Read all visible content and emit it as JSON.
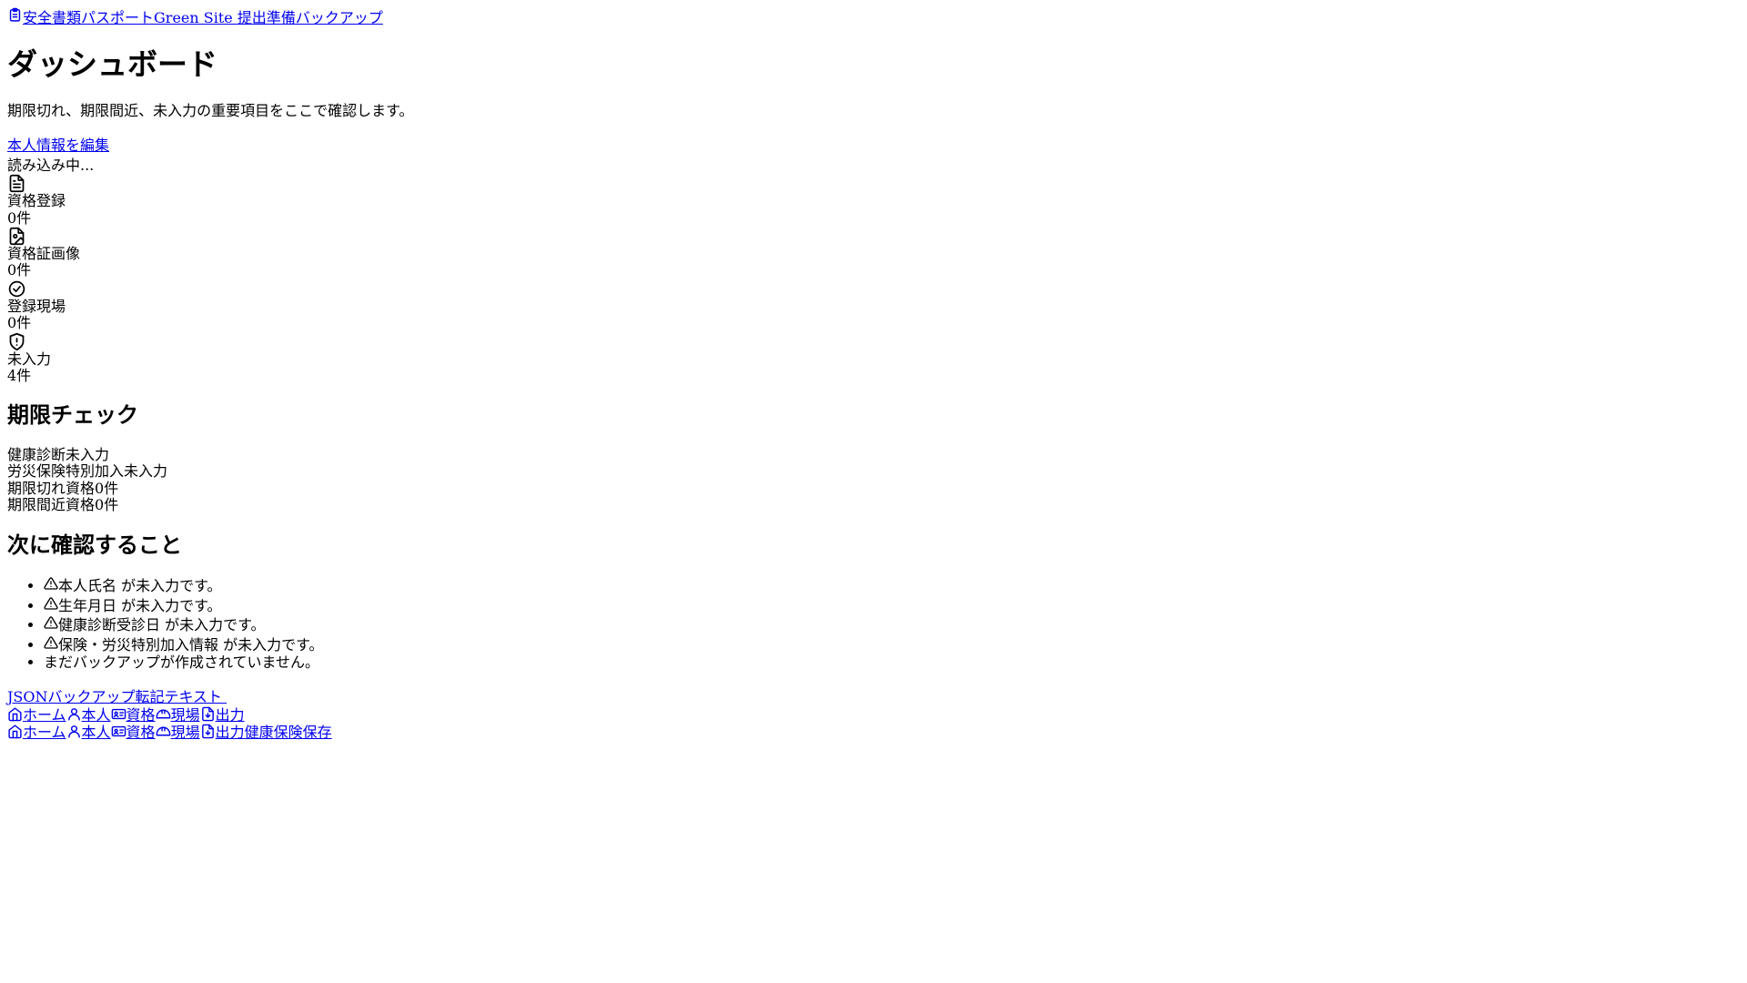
{
  "header": {
    "app_name": "安全書類パスポート",
    "links": [
      "Green Site 提出準備",
      "バックアップ"
    ]
  },
  "page": {
    "title": "ダッシュボード",
    "subtitle": "期限切れ、期限間近、未入力の重要項目をここで確認します。",
    "edit_link": "本人情報を編集",
    "loading": "読み込み中..."
  },
  "stats": [
    {
      "icon": "file-text-icon",
      "label": "資格登録",
      "value": "0件"
    },
    {
      "icon": "file-image-icon",
      "label": "資格証画像",
      "value": "0件"
    },
    {
      "icon": "check-circle-icon",
      "label": "登録現場",
      "value": "0件"
    },
    {
      "icon": "shield-alert-icon",
      "label": "未入力",
      "value": "4件"
    }
  ],
  "deadline": {
    "title": "期限チェック",
    "rows": [
      {
        "label": "健康診断",
        "value": "未入力"
      },
      {
        "label": "労災保険特別加入",
        "value": "未入力"
      },
      {
        "label": "期限切れ資格",
        "value": "0件"
      },
      {
        "label": "期限間近資格",
        "value": "0件"
      }
    ]
  },
  "next": {
    "title": "次に確認すること",
    "items": [
      {
        "icon": "warning-icon",
        "text": "本人氏名 が未入力です。"
      },
      {
        "icon": "warning-icon",
        "text": "生年月日 が未入力です。"
      },
      {
        "icon": "warning-icon",
        "text": "健康診断受診日 が未入力です。"
      },
      {
        "icon": "warning-icon",
        "text": "保険・労災特別加入情報 が未入力です。"
      },
      {
        "icon": "",
        "text": "まだバックアップが作成されていません。"
      }
    ]
  },
  "actions": {
    "json_backup": "JSONバックアップ",
    "transcript_text": "転記テキスト"
  },
  "bottom_nav": {
    "items": [
      {
        "icon": "home-icon",
        "label": "ホーム"
      },
      {
        "icon": "user-icon",
        "label": "本人"
      },
      {
        "icon": "id-card-icon",
        "label": "資格"
      },
      {
        "icon": "hard-hat-icon",
        "label": "現場"
      },
      {
        "icon": "file-export-icon",
        "label": "出力"
      }
    ]
  },
  "sidebar_nav": {
    "items": [
      {
        "icon": "home-icon",
        "label": "ホーム"
      },
      {
        "icon": "user-icon",
        "label": "本人"
      },
      {
        "icon": "id-card-icon",
        "label": "資格"
      },
      {
        "icon": "hard-hat-icon",
        "label": "現場"
      },
      {
        "icon": "file-export-icon",
        "label": "出力"
      }
    ],
    "extra_links": [
      "健康保険",
      "保存"
    ]
  }
}
